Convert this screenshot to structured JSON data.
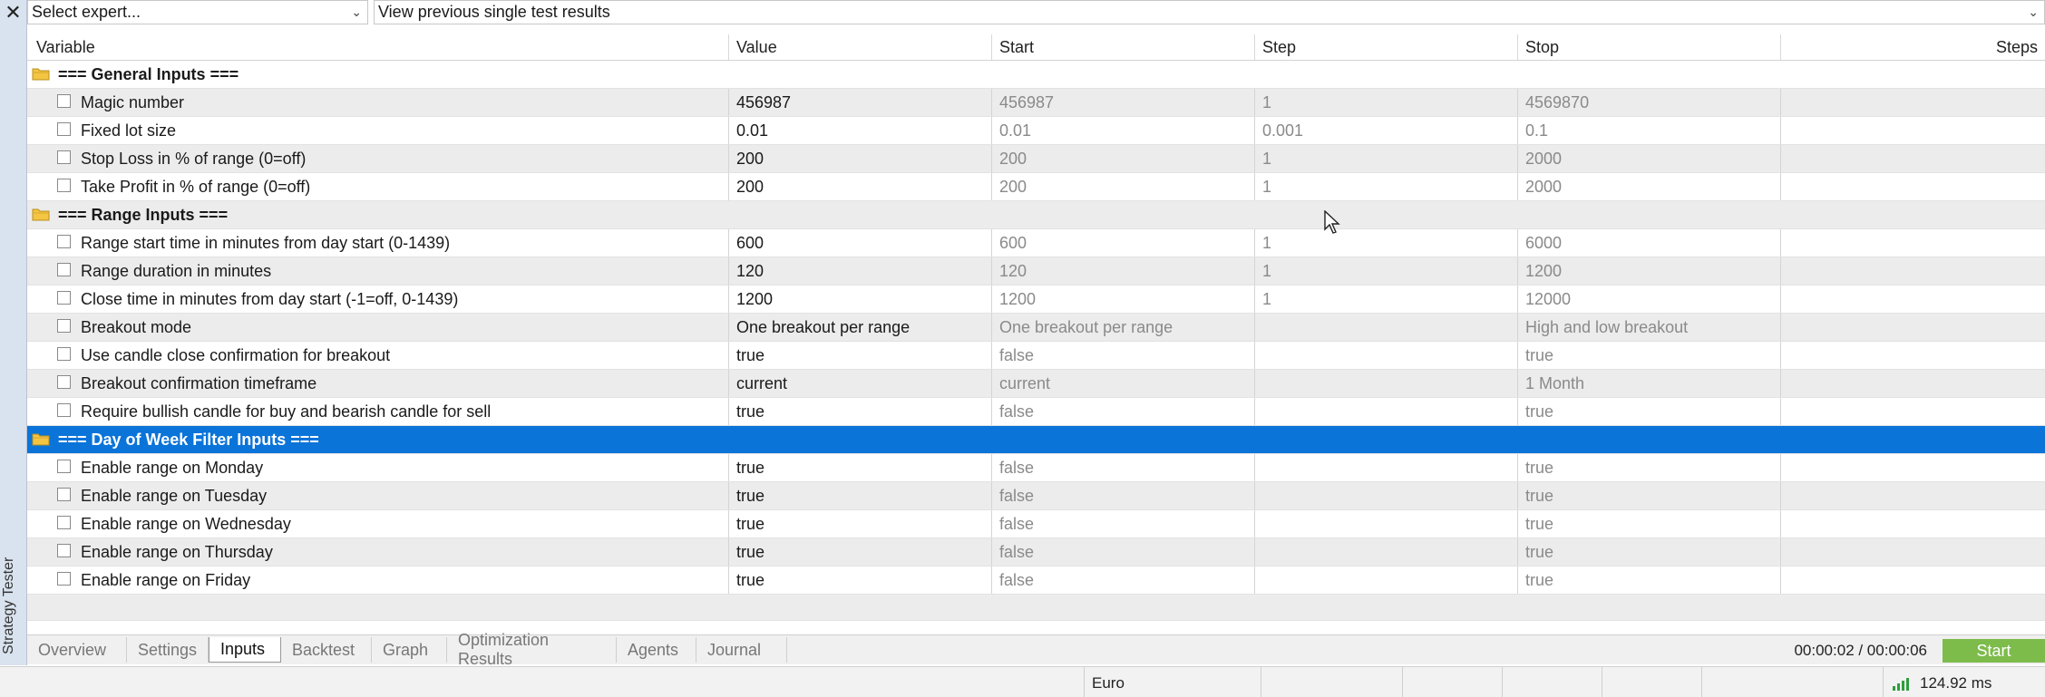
{
  "side": {
    "title": "Strategy Tester"
  },
  "topbar": {
    "expert_placeholder": "Select expert...",
    "history_value": "View previous single test results"
  },
  "columns": [
    "Variable",
    "Value",
    "Start",
    "Step",
    "Stop",
    "Steps"
  ],
  "groups": {
    "general": "=== General Inputs ===",
    "range": "=== Range Inputs ===",
    "dow": "=== Day of Week Filter Inputs ==="
  },
  "rows": [
    {
      "variable": "Magic number",
      "value": "456987",
      "start": "456987",
      "step": "1",
      "stop": "4569870"
    },
    {
      "variable": "Fixed lot size",
      "value": "0.01",
      "start": "0.01",
      "step": "0.001",
      "stop": "0.1"
    },
    {
      "variable": "Stop Loss in % of range (0=off)",
      "value": "200",
      "start": "200",
      "step": "1",
      "stop": "2000"
    },
    {
      "variable": "Take Profit in % of range (0=off)",
      "value": "200",
      "start": "200",
      "step": "1",
      "stop": "2000"
    },
    {
      "variable": "Range start time in minutes from day start (0-1439)",
      "value": "600",
      "start": "600",
      "step": "1",
      "stop": "6000"
    },
    {
      "variable": "Range duration in minutes",
      "value": "120",
      "start": "120",
      "step": "1",
      "stop": "1200"
    },
    {
      "variable": "Close time in minutes from day start (-1=off, 0-1439)",
      "value": "1200",
      "start": "1200",
      "step": "1",
      "stop": "12000"
    },
    {
      "variable": "Breakout mode",
      "value": "One breakout per range",
      "start": "One breakout per range",
      "step": "",
      "stop": "High and low breakout"
    },
    {
      "variable": "Use candle close confirmation for breakout",
      "value": "true",
      "start": "false",
      "step": "",
      "stop": "true"
    },
    {
      "variable": "Breakout confirmation timeframe",
      "value": "current",
      "start": "current",
      "step": "",
      "stop": "1 Month"
    },
    {
      "variable": "Require bullish candle for buy and bearish candle for sell",
      "value": "true",
      "start": "false",
      "step": "",
      "stop": "true"
    },
    {
      "variable": "Enable range on Monday",
      "value": "true",
      "start": "false",
      "step": "",
      "stop": "true"
    },
    {
      "variable": "Enable range on Tuesday",
      "value": "true",
      "start": "false",
      "step": "",
      "stop": "true"
    },
    {
      "variable": "Enable range on Wednesday",
      "value": "true",
      "start": "false",
      "step": "",
      "stop": "true"
    },
    {
      "variable": "Enable range on Thursday",
      "value": "true",
      "start": "false",
      "step": "",
      "stop": "true"
    },
    {
      "variable": "Enable range on Friday",
      "value": "true",
      "start": "false",
      "step": "",
      "stop": "true"
    }
  ],
  "tabs": [
    "Overview",
    "Settings",
    "Inputs",
    "Backtest",
    "Graph",
    "Optimization Results",
    "Agents",
    "Journal"
  ],
  "timer": "00:00:02 / 00:00:06",
  "start_label": "Start",
  "status": {
    "symbol": "Euro",
    "ping": "124.92 ms"
  },
  "colors": {
    "selection": "#0a74d9",
    "start_button": "#7dbb4b"
  }
}
